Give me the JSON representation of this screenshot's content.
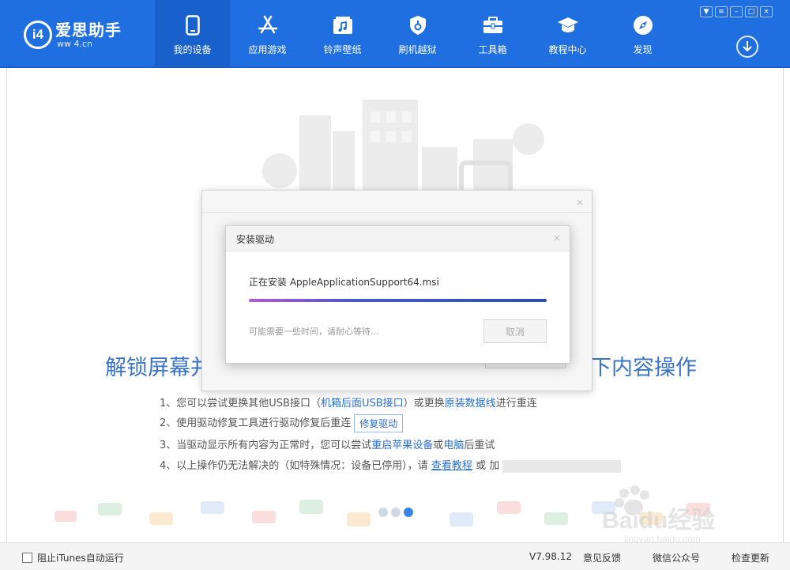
{
  "app": {
    "logo_text": "爱思助手",
    "logo_url_text": "ww    4.cn",
    "logo_mark": "i4"
  },
  "nav": {
    "items": [
      {
        "label": "我的设备",
        "icon": "phone-icon",
        "active": true
      },
      {
        "label": "应用游戏",
        "icon": "app-store-icon",
        "active": false
      },
      {
        "label": "铃声壁纸",
        "icon": "music-folder-icon",
        "active": false
      },
      {
        "label": "刷机越狱",
        "icon": "shield-icon",
        "active": false
      },
      {
        "label": "工具箱",
        "icon": "toolbox-icon",
        "active": false
      },
      {
        "label": "教程中心",
        "icon": "graduation-cap-icon",
        "active": false
      },
      {
        "label": "发现",
        "icon": "compass-icon",
        "active": false
      }
    ]
  },
  "main": {
    "headline_left": "解锁屏幕并",
    "headline_right": "下内容操作",
    "steps": {
      "s1_a": "1、您可以尝试更换其他USB接口（",
      "s1_link1": "机箱后面USB接口",
      "s1_b": "）或更换",
      "s1_link2": "原装数据线",
      "s1_c": "进行重连",
      "s2_a": "2、使用驱动修复工具进行驱动修复后重连",
      "s2_button": "修复驱动",
      "s3_a": "3、当驱动显示所有内容为正常时，您可以尝试",
      "s3_link1": "重启苹果设备",
      "s3_b": "或",
      "s3_link2": "电脑",
      "s3_c": "后重试",
      "s4_a": "4、以上操作仍无法解决的（如特殊情况：设备已停用），请",
      "s4_link": "查看教程",
      "s4_b": "或 ",
      "s4_c": "加"
    }
  },
  "dialog": {
    "title": "安装驱动",
    "close": "×",
    "outer_close": "×",
    "installing": "正在安装 AppleApplicationSupport64.msi",
    "progress": 1.0,
    "hint": "可能需要一些时间，请耐心等待...",
    "cancel": "取消"
  },
  "statusbar": {
    "itunes_label": "阻止iTunes自动运行",
    "version": "V7.98.12",
    "feedback": "意见反馈",
    "wechat": "微信公众号",
    "check_update": "检查更新"
  },
  "watermark": {
    "text": "Baidu经验",
    "url": "jingyan.baidu.com"
  },
  "colors": {
    "header_bg": "#1f6fe0",
    "accent": "#2a6fce",
    "headline": "#3b74c4"
  }
}
